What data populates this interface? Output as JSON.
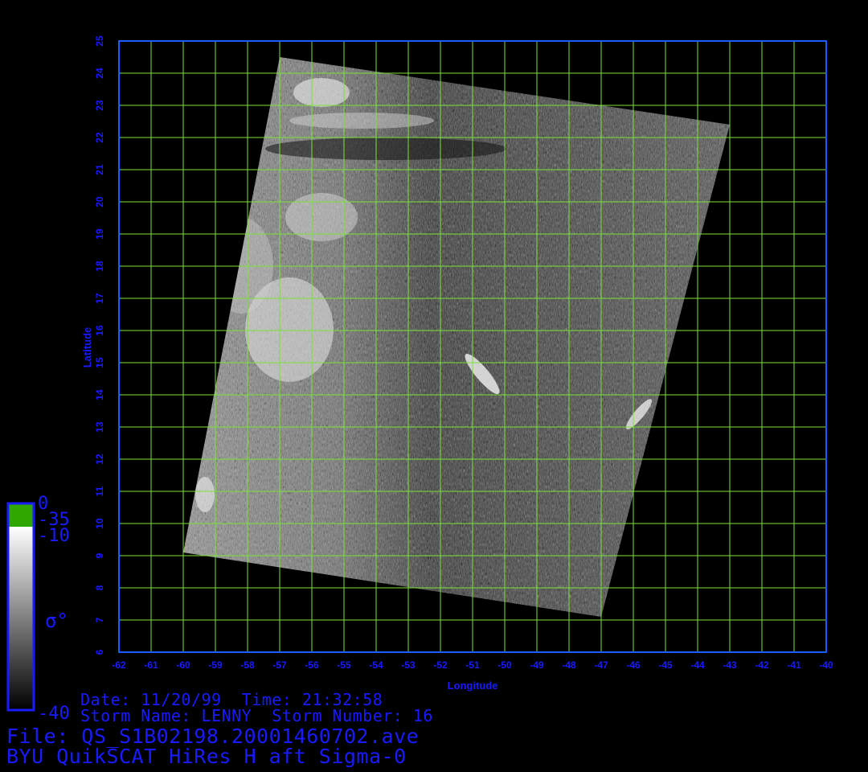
{
  "axes": {
    "x_label": "Longitude",
    "y_label": "Latitude",
    "x_ticks": [
      "-62",
      "-61",
      "-60",
      "-59",
      "-58",
      "-57",
      "-56",
      "-55",
      "-54",
      "-53",
      "-52",
      "-51",
      "-50",
      "-49",
      "-48",
      "-47",
      "-46",
      "-45",
      "-44",
      "-43",
      "-42",
      "-41",
      "-40"
    ],
    "y_ticks": [
      "6",
      "7",
      "8",
      "9",
      "10",
      "11",
      "12",
      "13",
      "14",
      "15",
      "16",
      "17",
      "18",
      "19",
      "20",
      "21",
      "22",
      "23",
      "24",
      "25"
    ],
    "x_range": [
      -62,
      -40
    ],
    "y_range": [
      6,
      25
    ],
    "grid": true
  },
  "swath_corners_lonlat": [
    [
      -57,
      24.5
    ],
    [
      -43,
      22.4
    ],
    [
      -47,
      7.1
    ],
    [
      -60,
      9.1
    ]
  ],
  "colorbar": {
    "symbol": "σ°",
    "labels": [
      "0",
      "-35",
      "-10",
      "-40"
    ],
    "top_color": "#2ea800"
  },
  "info": {
    "date_line": "Date: 11/20/99  Time: 21:32:58",
    "storm_line": "Storm Name: LENNY  Storm Number: 16",
    "file_line": "File: QS_S1B02198.20001460702.ave",
    "title_line": "BYU QuikSCAT HiRes H aft Sigma-0"
  },
  "colors": {
    "text": "#1a1aff",
    "frame": "#1a5cff",
    "grid": "#7ee03a"
  }
}
